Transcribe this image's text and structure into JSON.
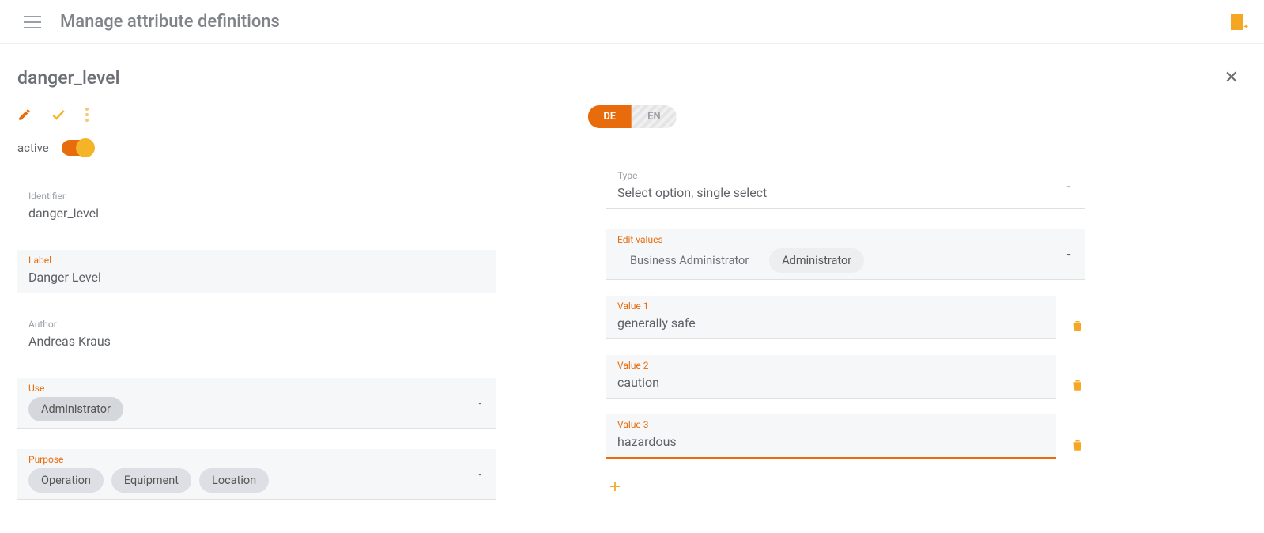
{
  "header": {
    "page_title": "Manage attribute definitions",
    "attribute_name": "danger_level"
  },
  "toolbar": {
    "lang_active": "DE",
    "lang_inactive": "EN"
  },
  "active": {
    "label": "active"
  },
  "left": {
    "identifier_label": "Identifier",
    "identifier_value": "danger_level",
    "label_label": "Label",
    "label_value": "Danger Level",
    "author_label": "Author",
    "author_value": "Andreas Kraus",
    "use_label": "Use",
    "use_chips": [
      "Administrator"
    ],
    "purpose_label": "Purpose",
    "purpose_chips": [
      "Operation",
      "Equipment",
      "Location"
    ]
  },
  "right": {
    "type_label": "Type",
    "type_value": "Select option, single select",
    "edit_values_label": "Edit values",
    "edit_values_chips": [
      "Business Administrator",
      "Administrator"
    ],
    "values": [
      {
        "label": "Value 1",
        "value": "generally safe"
      },
      {
        "label": "Value 2",
        "value": "caution"
      },
      {
        "label": "Value 3",
        "value": "hazardous"
      }
    ]
  },
  "colors": {
    "accent": "#e86c0c",
    "amber": "#f5a623"
  }
}
